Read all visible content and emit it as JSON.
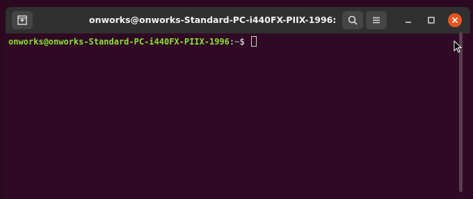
{
  "window": {
    "title": "onworks@onworks-Standard-PC-i440FX-PIIX-1996: ~"
  },
  "terminal": {
    "prompt_user_host": "onworks@onworks-Standard-PC-i440FX-PIIX-1996",
    "prompt_separator": ":",
    "prompt_path": "~",
    "prompt_symbol": "$ "
  },
  "icons": {
    "new_tab": "new-tab-icon",
    "search": "search-icon",
    "menu": "hamburger-menu-icon",
    "minimize": "minimize-icon",
    "maximize": "maximize-icon",
    "close": "close-icon",
    "pointer": "mouse-pointer-icon"
  },
  "colors": {
    "terminal_bg": "#300a24",
    "titlebar_bg": "#303030",
    "prompt_user": "#8ae234",
    "prompt_path": "#729fcf",
    "close_accent": "#e95420"
  }
}
